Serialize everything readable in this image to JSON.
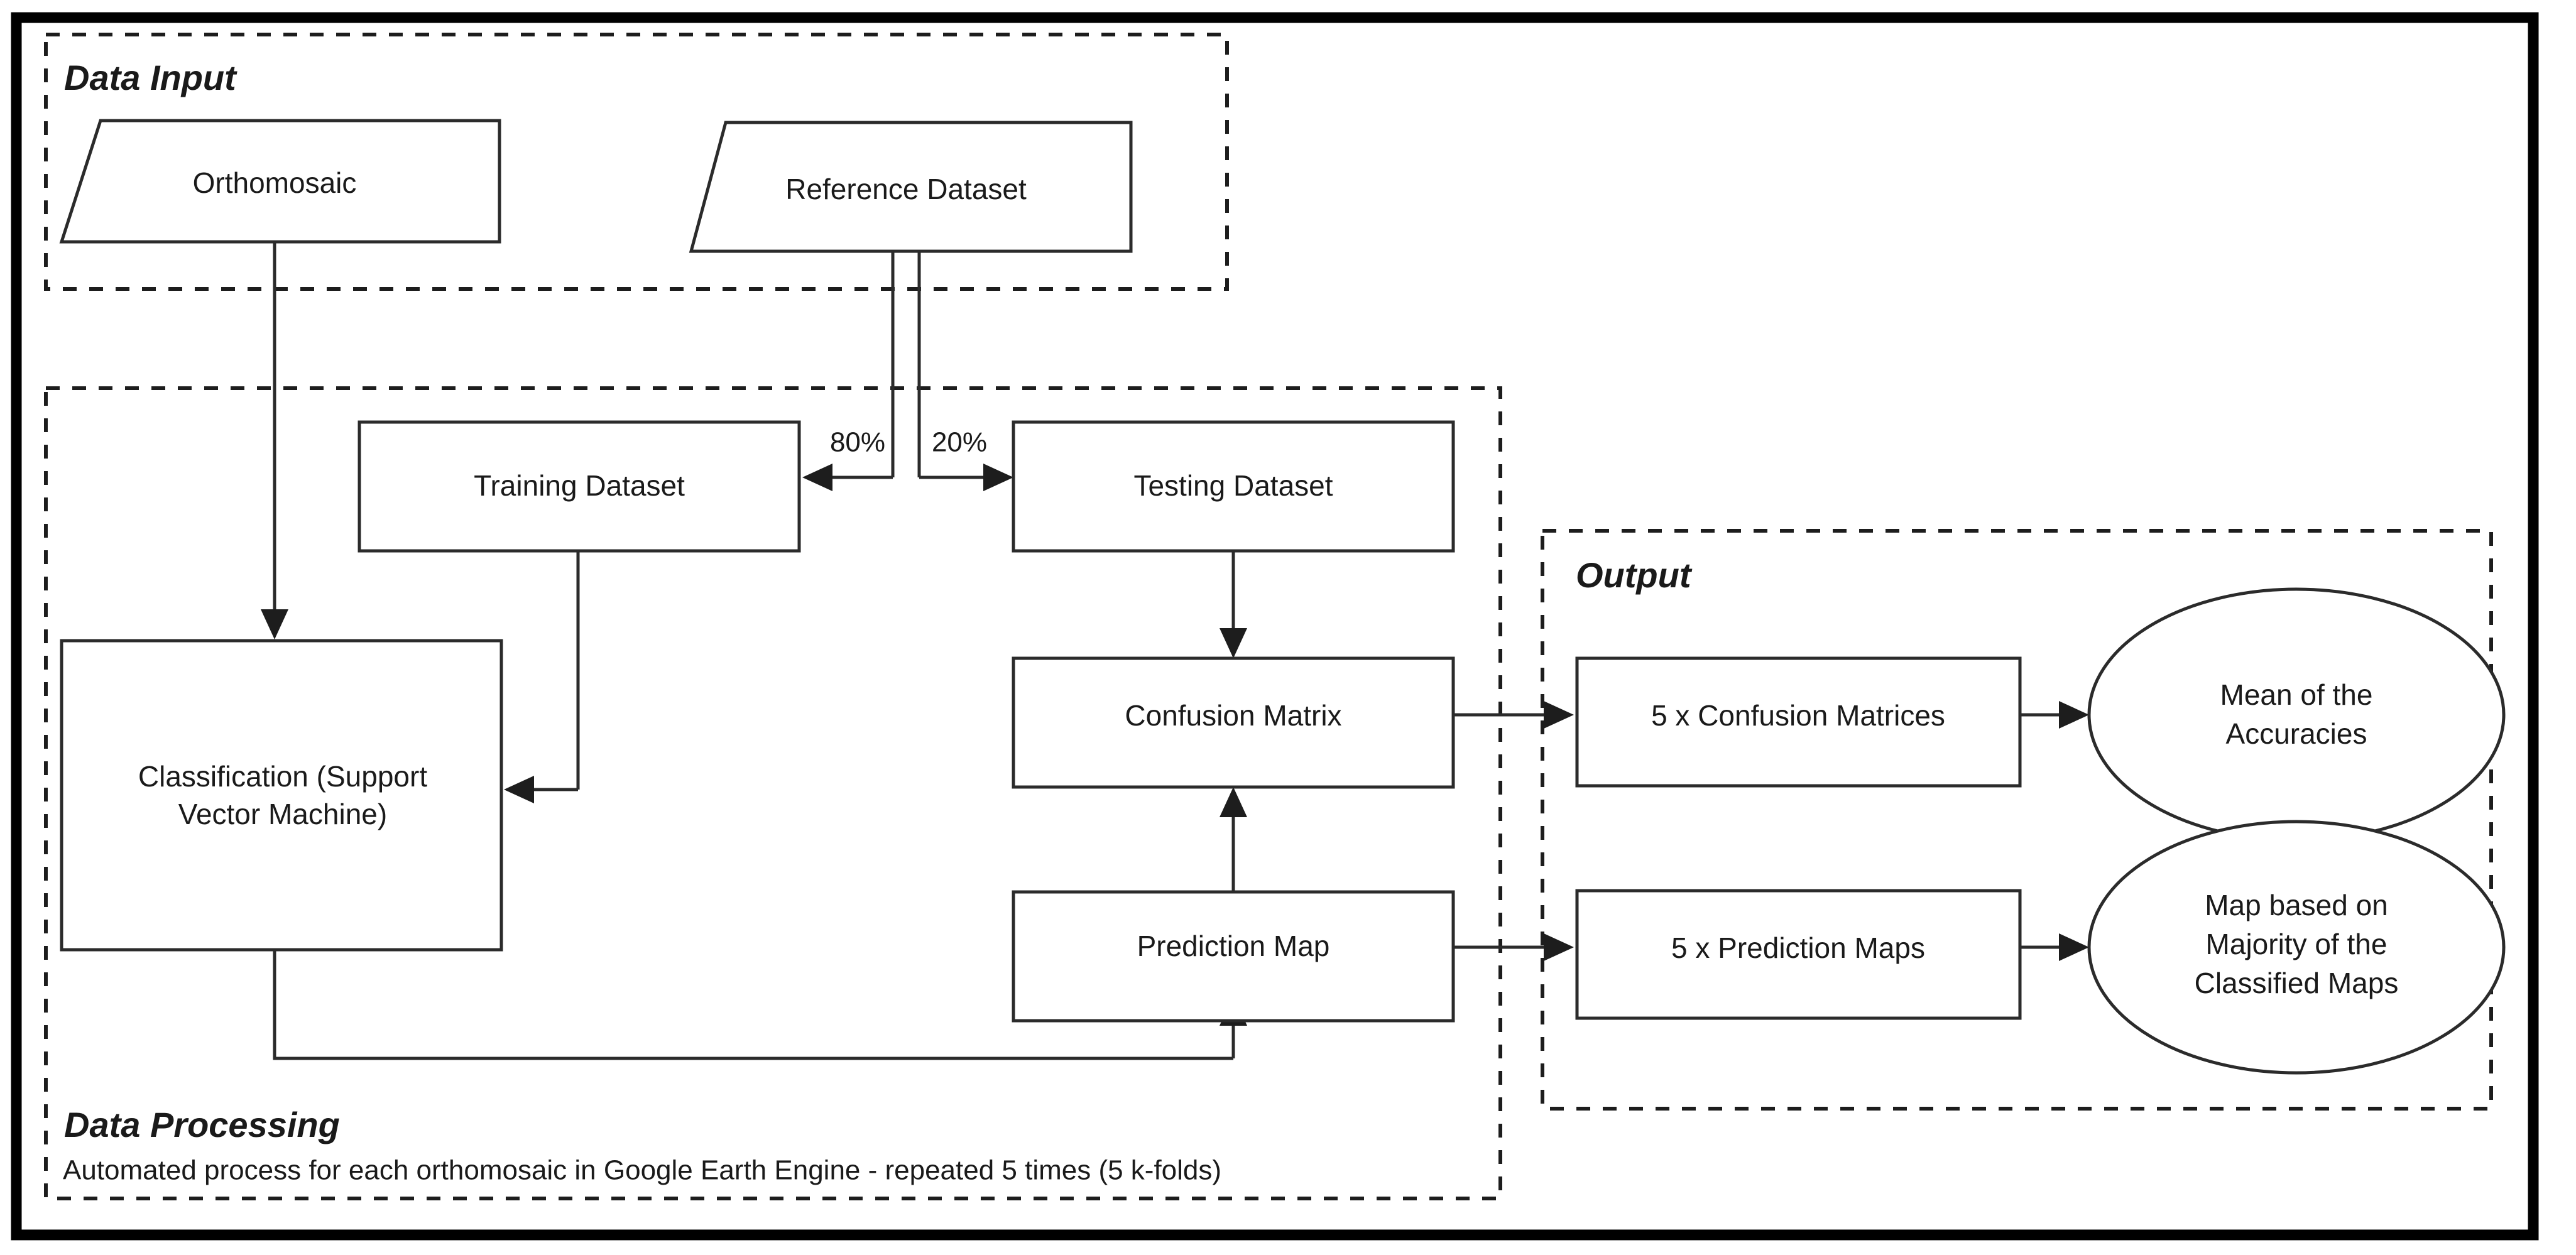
{
  "figure": {
    "type": "flowchart",
    "title": "Classification workflow flowchart",
    "frame_color": "#000000",
    "node_stroke_color": "#2b2b2b",
    "group_stroke_color": "#1d1d1d"
  },
  "groups": {
    "data_input": {
      "title": "Data Input"
    },
    "data_processing": {
      "title": "Data Processing",
      "subtitle": "Automated process for each orthomosaic in Google Earth Engine - repeated 5 times (5 k-folds)"
    },
    "output": {
      "title": "Output"
    }
  },
  "nodes": {
    "orthomosaic": {
      "label": "Orthomosaic",
      "shape": "parallelogram"
    },
    "reference_dataset": {
      "label": "Reference Dataset",
      "shape": "parallelogram"
    },
    "training_dataset": {
      "label": "Training Dataset",
      "shape": "rectangle"
    },
    "testing_dataset": {
      "label": "Testing Dataset",
      "shape": "rectangle"
    },
    "classification": {
      "label_line1": "Classification (Support",
      "label_line2": "Vector Machine)",
      "shape": "rectangle"
    },
    "confusion_matrix": {
      "label": "Confusion Matrix",
      "shape": "rectangle"
    },
    "prediction_map": {
      "label": "Prediction Map",
      "shape": "rectangle"
    },
    "five_confusion_matrices": {
      "label": "5 x Confusion Matrices",
      "shape": "rectangle"
    },
    "five_prediction_maps": {
      "label": "5 x Prediction Maps",
      "shape": "rectangle"
    },
    "mean_accuracies": {
      "label_line1": "Mean of the",
      "label_line2": "Accuracies",
      "shape": "ellipse"
    },
    "majority_map": {
      "label_line1": "Map based on",
      "label_line2": "Majority of the",
      "label_line3": "Classified Maps",
      "shape": "ellipse"
    }
  },
  "edges": {
    "split_training": {
      "label": "80%"
    },
    "split_testing": {
      "label": "20%"
    }
  }
}
